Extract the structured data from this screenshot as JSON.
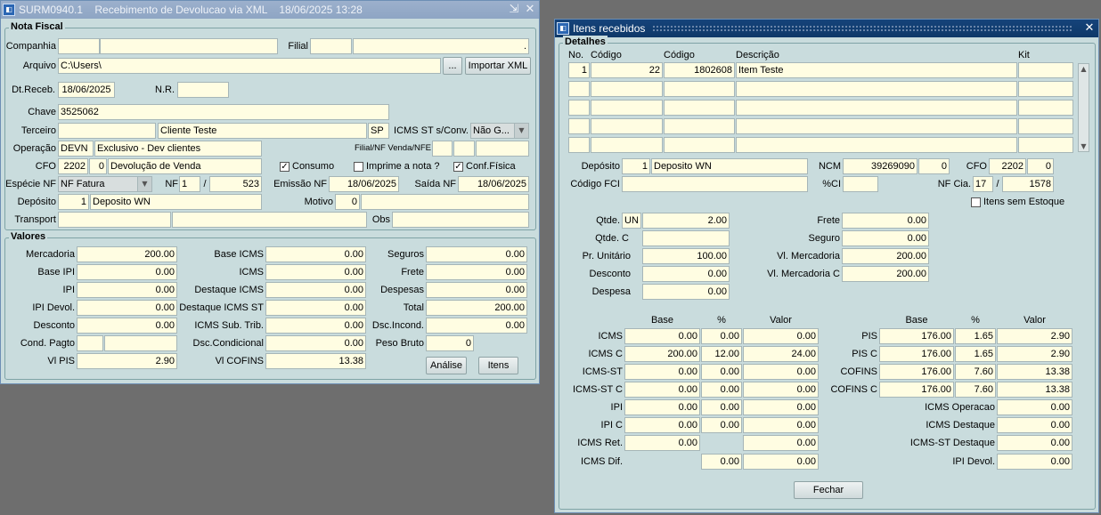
{
  "main": {
    "title": "SURM0940.1    Recebimento de Devolucao via XML    18/06/2025 13:28",
    "minimize": "⇲",
    "close": "✕",
    "nota": {
      "title": "Nota Fiscal",
      "companhia_label": "Companhia",
      "companhia_code": "",
      "companhia_name": "",
      "filial_label": "Filial",
      "filial_code": "",
      "filial_name": ".",
      "arquivo_label": "Arquivo",
      "arquivo_value": "C:\\Users\\",
      "browse_button": "...",
      "importar_button": "Importar XML",
      "dtreceb_label": "Dt.Receb.",
      "dtreceb_value": "18/06/2025",
      "nr_label": "N.R.",
      "nr_value": "",
      "chave_label": "Chave",
      "chave_value": "3525062",
      "terceiro_label": "Terceiro",
      "terceiro_code": "",
      "terceiro_name": "Cliente Teste",
      "terceiro_uf": "SP",
      "icms_st_label": "ICMS ST s/Conv.",
      "icms_st_value": "Não G...",
      "operacao_label": "Operação",
      "operacao_code": "DEVN",
      "operacao_desc": "Exclusivo - Dev clientes",
      "filial_nf_label": "Filial/NF Venda/NFE",
      "filial_nf_1": "",
      "filial_nf_2": "",
      "filial_nf_3": "",
      "cfo_label": "CFO",
      "cfo_code": "2202",
      "cfo_seq": "0",
      "cfo_desc": "Devolução de Venda",
      "consumo_label": "Consumo",
      "consumo_checked": "✓",
      "imprime_label": "Imprime a nota ?",
      "imprime_checked": "",
      "conf_fisica_label": "Conf.Física",
      "conf_fisica_checked": "✓",
      "especie_label": "Espécie NF",
      "especie_value": "NF Fatura",
      "nf_label": "NF",
      "nf_serie": "1",
      "nf_sep": "/",
      "nf_number": "523",
      "emissao_label": "Emissão NF",
      "emissao_value": "18/06/2025",
      "saida_label": "Saída NF",
      "saida_value": "18/06/2025",
      "deposito_label": "Depósito",
      "deposito_code": "1",
      "deposito_name": "Deposito WN",
      "motivo_label": "Motivo",
      "motivo_code": "0",
      "motivo_desc": "",
      "transport_label": "Transport",
      "transport_code": "",
      "transport_name": "",
      "obs_label": "Obs",
      "obs_value": ""
    },
    "valores": {
      "title": "Valores",
      "mercadoria_label": "Mercadoria",
      "mercadoria": "200.00",
      "base_ipi_label": "Base IPI",
      "base_ipi": "0.00",
      "ipi_label": "IPI",
      "ipi": "0.00",
      "ipi_devol_label": "IPI Devol.",
      "ipi_devol": "0.00",
      "desconto_label": "Desconto",
      "desconto": "0.00",
      "cond_pagto_label": "Cond. Pagto",
      "cond_pagto_code": "",
      "cond_pagto_desc": "",
      "vl_pis_label": "Vl PIS",
      "vl_pis": "2.90",
      "base_icms_label": "Base ICMS",
      "base_icms": "0.00",
      "icms_label": "ICMS",
      "icms": "0.00",
      "destaque_icms_label": "Destaque ICMS",
      "destaque_icms": "0.00",
      "destaque_icms_st_label": "Destaque ICMS ST",
      "destaque_icms_st": "0.00",
      "icms_sub_trib_label": "ICMS Sub. Trib.",
      "icms_sub_trib": "0.00",
      "dsc_condicional_label": "Dsc.Condicional",
      "dsc_condicional": "0.00",
      "vl_cofins_label": "Vl COFINS",
      "vl_cofins": "13.38",
      "seguros_label": "Seguros",
      "seguros": "0.00",
      "frete_label": "Frete",
      "frete": "0.00",
      "despesas_label": "Despesas",
      "despesas": "0.00",
      "total_label": "Total",
      "total": "200.00",
      "dsc_incond_label": "Dsc.Incond.",
      "dsc_incond": "0.00",
      "peso_bruto_label": "Peso Bruto",
      "peso_bruto": "0",
      "analise_button": "Análise",
      "itens_button": "Itens"
    }
  },
  "itens": {
    "title": "Itens recebidos",
    "close": "✕",
    "detalhes_title": "Detalhes",
    "col_no": "No.",
    "col_codigo1": "Código",
    "col_codigo2": "Código",
    "col_descricao": "Descrição",
    "col_kit": "Kit",
    "rows": [
      {
        "no": "1",
        "codigo1": "22",
        "codigo2": "1802608",
        "descricao": "Item Teste",
        "kit": ""
      },
      {
        "no": "",
        "codigo1": "",
        "codigo2": "",
        "descricao": "",
        "kit": ""
      },
      {
        "no": "",
        "codigo1": "",
        "codigo2": "",
        "descricao": "",
        "kit": ""
      },
      {
        "no": "",
        "codigo1": "",
        "codigo2": "",
        "descricao": "",
        "kit": ""
      },
      {
        "no": "",
        "codigo1": "",
        "codigo2": "",
        "descricao": "",
        "kit": ""
      }
    ],
    "deposito_label": "Depósito",
    "deposito_code": "1",
    "deposito_name": "Deposito WN",
    "ncm_label": "NCM",
    "ncm_code": "39269090",
    "ncm_seq": "0",
    "cfo_label": "CFO",
    "cfo_code": "2202",
    "cfo_seq": "0",
    "codigo_fci_label": "Código FCI",
    "codigo_fci": "",
    "pci_label": "%CI",
    "pci": "",
    "nf_cia_label": "NF Cia.",
    "nf_cia_serie": "17",
    "nf_cia_sep": "/",
    "nf_cia_number": "1578",
    "itens_sem_estoque_label": "Itens sem Estoque",
    "itens_sem_estoque_checked": "",
    "qtde_label": "Qtde.",
    "qtde_unit": "UN",
    "qtde": "2.00",
    "qtde_c_label": "Qtde. C",
    "qtde_c": "",
    "pr_unitario_label": "Pr. Unitário",
    "pr_unitario": "100.00",
    "desconto_label": "Desconto",
    "desconto": "0.00",
    "despesa_label": "Despesa",
    "despesa": "0.00",
    "frete_label": "Frete",
    "frete": "0.00",
    "seguro_label": "Seguro",
    "seguro": "0.00",
    "vl_mercadoria_label": "Vl. Mercadoria",
    "vl_mercadoria": "200.00",
    "vl_mercadoria_c_label": "Vl. Mercadoria C",
    "vl_mercadoria_c": "200.00",
    "tax_head_base": "Base",
    "tax_head_pct": "%",
    "tax_head_valor": "Valor",
    "icms_rows": [
      {
        "label": "ICMS",
        "base": "0.00",
        "pct": "0.00",
        "valor": "0.00"
      },
      {
        "label": "ICMS C",
        "base": "200.00",
        "pct": "12.00",
        "valor": "24.00"
      },
      {
        "label": "ICMS-ST",
        "base": "0.00",
        "pct": "0.00",
        "valor": "0.00"
      },
      {
        "label": "ICMS-ST C",
        "base": "0.00",
        "pct": "0.00",
        "valor": "0.00"
      },
      {
        "label": "IPI",
        "base": "0.00",
        "pct": "0.00",
        "valor": "0.00"
      },
      {
        "label": "IPI C",
        "base": "0.00",
        "pct": "0.00",
        "valor": "0.00"
      }
    ],
    "icms_ret_label": "ICMS Ret.",
    "icms_ret_base": "0.00",
    "icms_ret_valor": "0.00",
    "icms_dif_label": "ICMS Dif.",
    "icms_dif_pct": "0.00",
    "icms_dif_valor": "0.00",
    "pis_rows": [
      {
        "label": "PIS",
        "base": "176.00",
        "pct": "1.65",
        "valor": "2.90"
      },
      {
        "label": "PIS C",
        "base": "176.00",
        "pct": "1.65",
        "valor": "2.90"
      },
      {
        "label": "COFINS",
        "base": "176.00",
        "pct": "7.60",
        "valor": "13.38"
      },
      {
        "label": "COFINS C",
        "base": "176.00",
        "pct": "7.60",
        "valor": "13.38"
      }
    ],
    "icms_operacao_label": "ICMS Operacao",
    "icms_operacao": "0.00",
    "icms_destaque_label": "ICMS Destaque",
    "icms_destaque": "0.00",
    "icms_st_destaque_label": "ICMS-ST Destaque",
    "icms_st_destaque": "0.00",
    "ipi_devol_label": "IPI Devol.",
    "ipi_devol": "0.00",
    "fechar_button": "Fechar"
  }
}
